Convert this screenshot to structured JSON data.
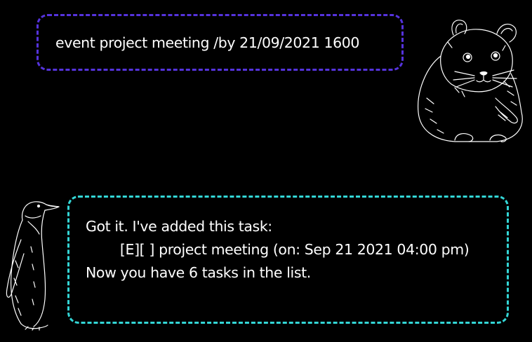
{
  "conversation": {
    "user_message": {
      "text": "event project meeting /by 21/09/2021 1600",
      "border_color": "#5533dd"
    },
    "bot_message": {
      "lines": [
        "Got it. I've added this task:",
        "        [E][ ] project meeting (on: Sep 21 2021 04:00 pm)",
        "",
        "Now you have 6 tasks in the list."
      ],
      "border_color": "#33d6d6"
    }
  },
  "avatars": {
    "user": "hamster-avatar",
    "bot": "penguin-avatar"
  }
}
